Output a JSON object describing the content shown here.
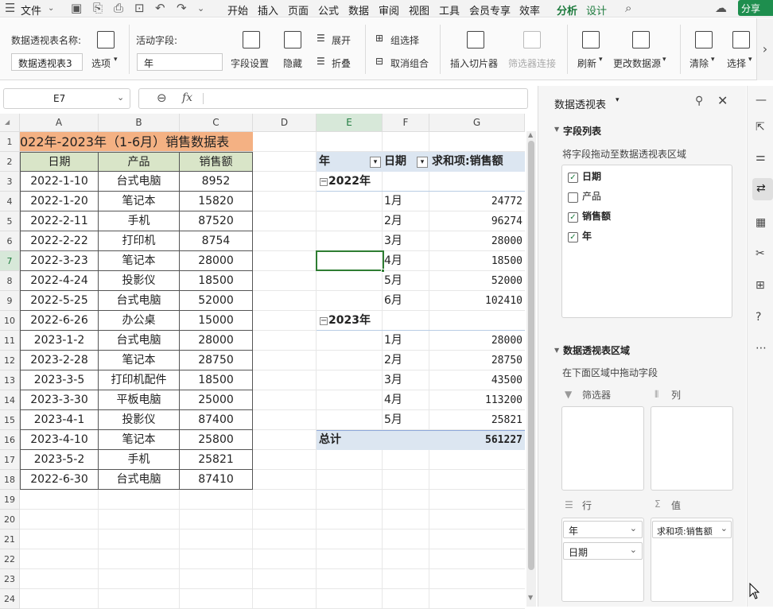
{
  "menubar": {
    "file": "文件",
    "tabs": [
      "开始",
      "插入",
      "页面",
      "公式",
      "数据",
      "审阅",
      "视图",
      "工具",
      "会员专享",
      "效率",
      "分析",
      "设计"
    ],
    "active_tab": "分析",
    "share": "分享"
  },
  "ribbon": {
    "pivot_name_label": "数据透视表名称:",
    "pivot_name_value": "数据透视表3",
    "options": "选项",
    "active_field_label": "活动字段:",
    "active_field_value": "年",
    "field_settings": "字段设置",
    "hide": "隐藏",
    "expand": "展开",
    "collapse": "折叠",
    "group_select": "组选择",
    "ungroup": "取消组合",
    "insert_slicer": "插入切片器",
    "filter_connections": "筛选器连接",
    "refresh": "刷新",
    "change_source": "更改数据源",
    "clear": "清除",
    "select": "选择"
  },
  "formula_bar": {
    "cell_ref": "E7",
    "fx": "fx",
    "content": ""
  },
  "columns": [
    "A",
    "B",
    "C",
    "D",
    "E",
    "F",
    "G"
  ],
  "selected_col": "E",
  "selected_row": 7,
  "rows": [
    "1",
    "2",
    "3",
    "4",
    "5",
    "6",
    "7",
    "8",
    "9",
    "10",
    "11",
    "12",
    "13",
    "14",
    "15",
    "16",
    "17",
    "18",
    "19",
    "20",
    "21",
    "22",
    "23",
    "24"
  ],
  "table": {
    "title": "022年-2023年（1-6月）销售数据表",
    "headers": [
      "日期",
      "产品",
      "销售额"
    ],
    "rows": [
      [
        "2022-1-10",
        "台式电脑",
        "8952"
      ],
      [
        "2022-1-20",
        "笔记本",
        "15820"
      ],
      [
        "2022-2-11",
        "手机",
        "87520"
      ],
      [
        "2022-2-22",
        "打印机",
        "8754"
      ],
      [
        "2022-3-23",
        "笔记本",
        "28000"
      ],
      [
        "2022-4-24",
        "投影仪",
        "18500"
      ],
      [
        "2022-5-25",
        "台式电脑",
        "52000"
      ],
      [
        "2022-6-26",
        "办公桌",
        "15000"
      ],
      [
        "2023-1-2",
        "台式电脑",
        "28000"
      ],
      [
        "2023-2-28",
        "笔记本",
        "28750"
      ],
      [
        "2023-3-5",
        "打印机配件",
        "18500"
      ],
      [
        "2023-3-30",
        "平板电脑",
        "25000"
      ],
      [
        "2023-4-1",
        "投影仪",
        "87400"
      ],
      [
        "2023-4-10",
        "笔记本",
        "25800"
      ],
      [
        "2023-5-2",
        "手机",
        "25821"
      ],
      [
        "2022-6-30",
        "台式电脑",
        "87410"
      ]
    ]
  },
  "pivot": {
    "header_year": "年",
    "header_date": "日期",
    "header_value": "求和项:销售额",
    "groups": [
      {
        "year": "2022年",
        "items": [
          [
            "1月",
            "24772"
          ],
          [
            "2月",
            "96274"
          ],
          [
            "3月",
            "28000"
          ],
          [
            "4月",
            "18500"
          ],
          [
            "5月",
            "52000"
          ],
          [
            "6月",
            "102410"
          ]
        ]
      },
      {
        "year": "2023年",
        "items": [
          [
            "1月",
            "28000"
          ],
          [
            "2月",
            "28750"
          ],
          [
            "3月",
            "43500"
          ],
          [
            "4月",
            "113200"
          ],
          [
            "5月",
            "25821"
          ]
        ]
      }
    ],
    "total_label": "总计",
    "total_value": "561227"
  },
  "pane": {
    "title": "数据透视表",
    "field_list_title": "字段列表",
    "field_hint": "将字段拖动至数据透视表区域",
    "fields": [
      {
        "label": "日期",
        "checked": true
      },
      {
        "label": "产品",
        "checked": false
      },
      {
        "label": "销售额",
        "checked": true
      },
      {
        "label": "年",
        "checked": true
      }
    ],
    "areas_title": "数据透视表区域",
    "areas_hint": "在下面区域中拖动字段",
    "filter_label": "筛选器",
    "column_label": "列",
    "row_label": "行",
    "value_label": "值",
    "row_fields": [
      "年",
      "日期"
    ],
    "value_fields": [
      "求和项:销售额"
    ]
  },
  "colors": {
    "accent": "#1e7b3e",
    "title_fill": "#f4b183",
    "header_fill": "#d9e5c8",
    "pivot_header": "#dce6f1"
  }
}
